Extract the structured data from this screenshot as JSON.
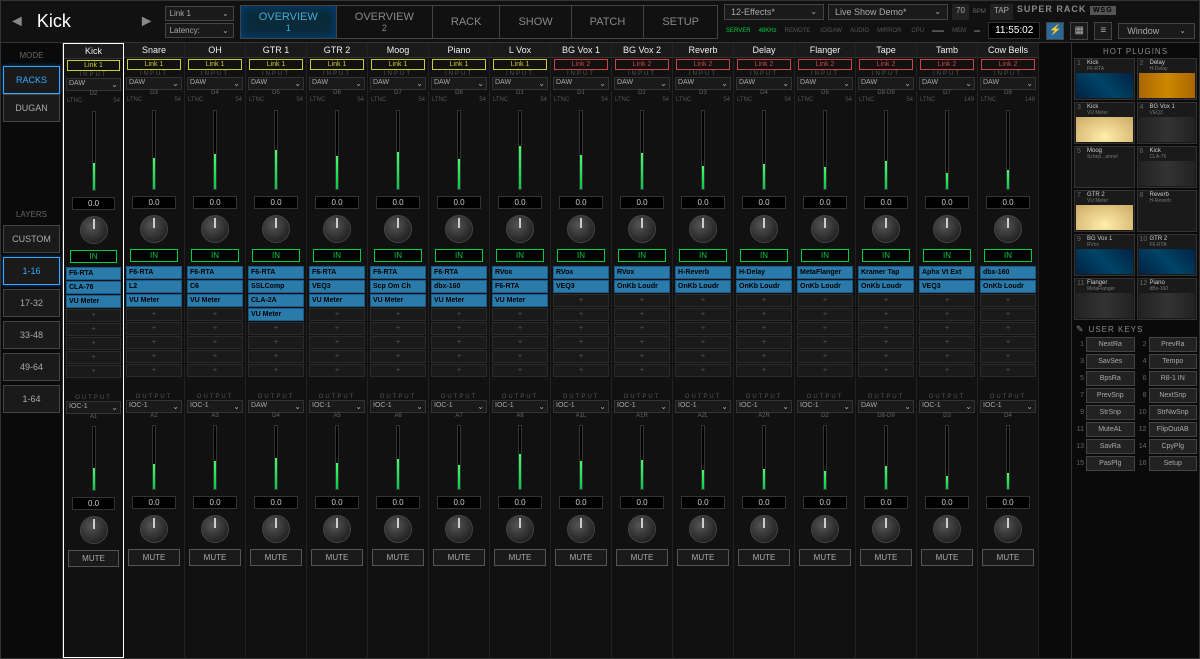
{
  "header": {
    "channel_name": "Kick",
    "link_select": "Link 1",
    "latency_label": "Latency:",
    "tabs": [
      {
        "label": "OVERVIEW",
        "sub": "1",
        "active": true
      },
      {
        "label": "OVERVIEW",
        "sub": "2",
        "active": false
      },
      {
        "label": "RACK",
        "sub": "",
        "active": false
      },
      {
        "label": "SHOW",
        "sub": "",
        "active": false
      },
      {
        "label": "PATCH",
        "sub": "",
        "active": false
      },
      {
        "label": "SETUP",
        "sub": "",
        "active": false
      }
    ],
    "scene": "12-Effects*",
    "session": "Live Show Demo*",
    "bpm": "70",
    "bpm_label": "BPM",
    "tap": "TAP",
    "brand": "SUPER RACK",
    "wsg": "WSG",
    "clock": "11:55:02",
    "window": "Window",
    "status": {
      "server": "SERVER",
      "iodaw": "IO/DAW",
      "khz": "48KHz",
      "audio": "AUDIO",
      "remote": "REMOTE",
      "mirror": "MIRROR",
      "cpu": "CPU",
      "mem": "MEM"
    }
  },
  "leftbar": {
    "mode_label": "MODE",
    "mode": [
      {
        "label": "RACKS",
        "active": true
      },
      {
        "label": "DUGAN",
        "active": false
      }
    ],
    "layers_label": "LAYERS",
    "layers": [
      {
        "label": "CUSTOM",
        "active": false
      },
      {
        "label": "1-16",
        "active": true
      },
      {
        "label": "17-32",
        "active": false
      },
      {
        "label": "33-48",
        "active": false
      },
      {
        "label": "49-64",
        "active": false
      },
      {
        "label": "1-64",
        "active": false
      }
    ]
  },
  "io_labels": {
    "input": "INPUT",
    "output": "OUTPUT",
    "ltnc": "LTNC",
    "in": "IN",
    "mute": "MUTE",
    "daw": "DAW",
    "ioc": "IOC-1"
  },
  "channels": [
    {
      "name": "Kick",
      "link": "Link 1",
      "lc": "l1",
      "in_src": "DAW",
      "in_sub": "D2",
      "ltnc": "54",
      "in_val": "0.0",
      "slots": [
        "F6-RTA",
        "CLA-76",
        "VU Meter"
      ],
      "out_src": "IOC-1",
      "out_sub": "A1",
      "out_val": "0.0",
      "sel": true,
      "mf": 35
    },
    {
      "name": "Snare",
      "link": "Link 1",
      "lc": "l1",
      "in_src": "DAW",
      "in_sub": "D3",
      "ltnc": "54",
      "in_val": "0.0",
      "slots": [
        "F6-RTA",
        "L2",
        "VU Meter"
      ],
      "out_src": "IOC-1",
      "out_sub": "A2",
      "out_val": "0.0",
      "mf": 40
    },
    {
      "name": "OH",
      "link": "Link 1",
      "lc": "l1",
      "in_src": "DAW",
      "in_sub": "D4",
      "ltnc": "54",
      "in_val": "0.0",
      "slots": [
        "F6-RTA",
        "C6",
        "VU Meter"
      ],
      "out_src": "IOC-1",
      "out_sub": "A3",
      "out_val": "0.0",
      "mf": 45
    },
    {
      "name": "GTR 1",
      "link": "Link 1",
      "lc": "l1",
      "in_src": "DAW",
      "in_sub": "D5",
      "ltnc": "54",
      "in_val": "0.0",
      "slots": [
        "F6-RTA",
        "SSLComp",
        "CLA-2A",
        "VU Meter"
      ],
      "out_src": "DAW",
      "out_sub": "D4",
      "out_val": "0.0",
      "mf": 50
    },
    {
      "name": "GTR 2",
      "link": "Link 1",
      "lc": "l1",
      "in_src": "DAW",
      "in_sub": "D6",
      "ltnc": "54",
      "in_val": "0.0",
      "slots": [
        "F6-RTA",
        "VEQ3",
        "VU Meter"
      ],
      "out_src": "IOC-1",
      "out_sub": "A5",
      "out_val": "0.0",
      "mf": 42
    },
    {
      "name": "Moog",
      "link": "Link 1",
      "lc": "l1",
      "in_src": "DAW",
      "in_sub": "D7",
      "ltnc": "54",
      "in_val": "0.0",
      "slots": [
        "F6-RTA",
        "Scp Om Ch",
        "VU Meter"
      ],
      "out_src": "IOC-1",
      "out_sub": "A6",
      "out_val": "0.0",
      "mf": 48
    },
    {
      "name": "Piano",
      "link": "Link 1",
      "lc": "l1",
      "in_src": "DAW",
      "in_sub": "D8",
      "ltnc": "54",
      "in_val": "0.0",
      "slots": [
        "F6-RTA",
        "dbx-160",
        "VU Meter"
      ],
      "out_src": "IOC-1",
      "out_sub": "A7",
      "out_val": "0.0",
      "mf": 38
    },
    {
      "name": "L Vox",
      "link": "Link 1",
      "lc": "l1",
      "in_src": "DAW",
      "in_sub": "D1",
      "ltnc": "54",
      "in_val": "0.0",
      "slots": [
        "RVox",
        "F6-RTA",
        "VU Meter"
      ],
      "out_src": "IOC-1",
      "out_sub": "A8",
      "out_val": "0.0",
      "mf": 55
    },
    {
      "name": "BG Vox 1",
      "link": "Link 2",
      "lc": "l2",
      "in_src": "DAW",
      "in_sub": "D1",
      "ltnc": "54",
      "in_val": "0.0",
      "slots": [
        "RVox",
        "VEQ3"
      ],
      "out_src": "IOC-1",
      "out_sub": "A1L",
      "out_val": "0.0",
      "mf": 44
    },
    {
      "name": "BG Vox 2",
      "link": "Link 2",
      "lc": "l2",
      "in_src": "DAW",
      "in_sub": "D2",
      "ltnc": "54",
      "in_val": "0.0",
      "slots": [
        "RVox",
        "OnKb Loudr"
      ],
      "out_src": "IOC-1",
      "out_sub": "A1R",
      "out_val": "0.0",
      "mf": 46
    },
    {
      "name": "Reverb",
      "link": "Link 2",
      "lc": "l2",
      "in_src": "DAW",
      "in_sub": "D3",
      "ltnc": "54",
      "in_val": "0.0",
      "slots": [
        "H-Reverb",
        "OnKb Loudr"
      ],
      "out_src": "IOC-1",
      "out_sub": "A2L",
      "out_val": "0.0",
      "mf": 30
    },
    {
      "name": "Delay",
      "link": "Link 2",
      "lc": "l2",
      "in_src": "DAW",
      "in_sub": "D4",
      "ltnc": "54",
      "in_val": "0.0",
      "slots": [
        "H-Delay",
        "OnKb Loudr"
      ],
      "out_src": "IOC-1",
      "out_sub": "A2R",
      "out_val": "0.0",
      "mf": 32
    },
    {
      "name": "Flanger",
      "link": "Link 2",
      "lc": "l2",
      "in_src": "DAW",
      "in_sub": "D5",
      "ltnc": "54",
      "in_val": "0.0",
      "slots": [
        "MetaFlanger",
        "OnKb Loudr"
      ],
      "out_src": "IOC-1",
      "out_sub": "D2",
      "out_val": "0.0",
      "mf": 28
    },
    {
      "name": "Tape",
      "link": "Link 2",
      "lc": "l2",
      "in_src": "DAW",
      "in_sub": "D8-D9",
      "ltnc": "54",
      "in_val": "0.0",
      "slots": [
        "Kramer Tap",
        "OnKb Loudr"
      ],
      "out_src": "DAW",
      "out_sub": "D8-D9",
      "out_val": "0.0",
      "mf": 36
    },
    {
      "name": "Tamb",
      "link": "Link 2",
      "lc": "l2",
      "in_src": "DAW",
      "in_sub": "D7",
      "ltnc": "149",
      "in_val": "0.0",
      "slots": [
        "Aphx Vt Ext",
        "VEQ3"
      ],
      "out_src": "IOC-1",
      "out_sub": "D3",
      "out_val": "0.0",
      "mf": 20
    },
    {
      "name": "Cow Bells",
      "link": "Link 2",
      "lc": "l2",
      "in_src": "DAW",
      "in_sub": "D8",
      "ltnc": "149",
      "in_val": "0.0",
      "slots": [
        "dbx-160",
        "OnKb Loudr"
      ],
      "out_src": "IOC-1",
      "out_sub": "D4",
      "out_val": "0.0",
      "mf": 25
    }
  ],
  "hot_plugins": {
    "title": "HOT PLUGINS",
    "items": [
      {
        "n": "1",
        "name": "Kick",
        "sub": "F6-RTA",
        "c": "pi-blue"
      },
      {
        "n": "2",
        "name": "Delay",
        "sub": "H-Delay",
        "c": "pi-orange"
      },
      {
        "n": "3",
        "name": "Kick",
        "sub": "VU Meter",
        "c": "pi-vu"
      },
      {
        "n": "4",
        "name": "BG Vox 1",
        "sub": "VEQ3",
        "c": "pi-rack"
      },
      {
        "n": "5",
        "name": "Moog",
        "sub": "Schep...annel",
        "c": "pi-dark"
      },
      {
        "n": "6",
        "name": "Kick",
        "sub": "CLA-76",
        "c": "pi-rack"
      },
      {
        "n": "7",
        "name": "GTR 2",
        "sub": "VU Meter",
        "c": "pi-vu"
      },
      {
        "n": "8",
        "name": "Reverb",
        "sub": "H-Reverb",
        "c": "pi-dark"
      },
      {
        "n": "9",
        "name": "BG Vox 1",
        "sub": "RVox",
        "c": "pi-blue"
      },
      {
        "n": "10",
        "name": "GTR 2",
        "sub": "F6-RTA",
        "c": "pi-blue"
      },
      {
        "n": "11",
        "name": "Flanger",
        "sub": "MetaFlanger",
        "c": "pi-rack"
      },
      {
        "n": "12",
        "name": "Piano",
        "sub": "dBx-160",
        "c": "pi-rack"
      }
    ]
  },
  "user_keys": {
    "title": "USER KEYS",
    "items": [
      {
        "n": "1",
        "l": "NextRa"
      },
      {
        "n": "2",
        "l": "PrevRa"
      },
      {
        "n": "3",
        "l": "SavSes"
      },
      {
        "n": "4",
        "l": "Tempo"
      },
      {
        "n": "5",
        "l": "BpsRa"
      },
      {
        "n": "6",
        "l": "R8-1 IN"
      },
      {
        "n": "7",
        "l": "PrevSnp"
      },
      {
        "n": "8",
        "l": "NextSnp"
      },
      {
        "n": "9",
        "l": "StrSnp"
      },
      {
        "n": "10",
        "l": "StrNwSnp"
      },
      {
        "n": "11",
        "l": "MuteAL"
      },
      {
        "n": "12",
        "l": "FlipOutAB"
      },
      {
        "n": "13",
        "l": "SavRa"
      },
      {
        "n": "14",
        "l": "CpyPlg"
      },
      {
        "n": "15",
        "l": "PasPlg"
      },
      {
        "n": "16",
        "l": "Setup"
      }
    ]
  }
}
